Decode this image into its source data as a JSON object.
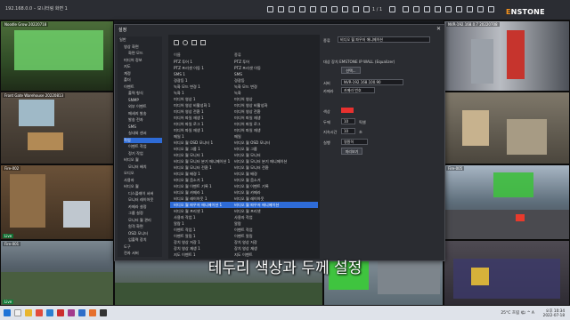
{
  "app": {
    "title": "192.168.0.0 – 모니터링 화면 1",
    "page_indicator": "1 / 1",
    "logo_prefix": "E",
    "logo_rest": "NSTONE"
  },
  "cameras": [
    {
      "label": "Noodle Grow 20220718",
      "foot": ""
    },
    {
      "label": "",
      "foot": ""
    },
    {
      "label": "",
      "foot": ""
    },
    {
      "label": "NVR-192.168.0.7 20220708",
      "foot": ""
    },
    {
      "label": "Front Gate Warehouse 20220813",
      "foot": ""
    },
    {
      "label": "",
      "foot": ""
    },
    {
      "label": "Fire-002",
      "foot": "Live"
    },
    {
      "label": "Fire-005",
      "foot": ""
    },
    {
      "label": "Fire-001",
      "foot": "Live"
    },
    {
      "label": "",
      "foot": ""
    }
  ],
  "dialog": {
    "title": "설정",
    "close": "✕",
    "tree": [
      {
        "label": "일반",
        "indent": 0
      },
      {
        "label": "영상 화면",
        "indent": 1
      },
      {
        "label": "화면 모드",
        "indent": 2
      },
      {
        "label": "미디어 정보",
        "indent": 1
      },
      {
        "label": "지도",
        "indent": 1
      },
      {
        "label": "계정",
        "indent": 1
      },
      {
        "label": "폴더",
        "indent": 1
      },
      {
        "label": "이벤트",
        "indent": 1
      },
      {
        "label": "출력 형식",
        "indent": 2
      },
      {
        "label": "SNMP",
        "indent": 2
      },
      {
        "label": "외부 이벤트",
        "indent": 2
      },
      {
        "label": "메세지 발송",
        "indent": 2
      },
      {
        "label": "발송 전자",
        "indent": 2
      },
      {
        "label": "SMS",
        "indent": 2
      },
      {
        "label": "실내외 센서",
        "indent": 2
      },
      {
        "label": "작업",
        "indent": 1,
        "selected": true
      },
      {
        "label": "이벤트 작업",
        "indent": 2
      },
      {
        "label": "정기 작업",
        "indent": 2
      },
      {
        "label": "비디오 월",
        "indent": 1
      },
      {
        "label": "모니터 배치",
        "indent": 2
      },
      {
        "label": "오디오",
        "indent": 1
      },
      {
        "label": "사용자",
        "indent": 1
      },
      {
        "label": "비디오 월",
        "indent": 1
      },
      {
        "label": "디스플레이 서버",
        "indent": 2
      },
      {
        "label": "모니터 레이아웃",
        "indent": 2
      },
      {
        "label": "카메라 설정",
        "indent": 2
      },
      {
        "label": "그룹 설정",
        "indent": 2
      },
      {
        "label": "모니터 월 관리",
        "indent": 2
      },
      {
        "label": "원격 화면",
        "indent": 2
      },
      {
        "label": "OSD 모니터",
        "indent": 2
      },
      {
        "label": "입출력 장치",
        "indent": 2
      },
      {
        "label": "도구",
        "indent": 1
      },
      {
        "label": "전자 서버",
        "indent": 1
      }
    ],
    "list_headers": {
      "name": "이름",
      "type": "종류"
    },
    "list": [
      {
        "name": "PTZ 투어 1",
        "type": "PTZ 투어"
      },
      {
        "name": "PTZ 프리셋 이동 1",
        "type": "PTZ 프리셋 이동"
      },
      {
        "name": "SMS 1",
        "type": "SMS"
      },
      {
        "name": "경광등 1",
        "type": "경광등"
      },
      {
        "name": "녹화 모드 변경 1",
        "type": "녹화 모드 변경"
      },
      {
        "name": "녹화 1",
        "type": "녹화"
      },
      {
        "name": "미디어 영상 1",
        "type": "미디어 영상"
      },
      {
        "name": "미디어 영상 비활성화 1",
        "type": "미디어 영상 비활성화"
      },
      {
        "name": "미디어 영상 전환 1",
        "type": "미디어 영상 전환"
      },
      {
        "name": "미디어 파일 재생 1",
        "type": "미디어 파일 재생"
      },
      {
        "name": "미디어 파일 로그 1",
        "type": "미디어 파일 로그"
      },
      {
        "name": "미디어 파일 재생 1",
        "type": "미디어 파일 재생"
      },
      {
        "name": "메일 1",
        "type": "메일"
      },
      {
        "name": "비디오 월 OSD 모니터 1",
        "type": "비디오 월 OSD 모니터"
      },
      {
        "name": "비디오 월 그룹 1",
        "type": "비디오 월 그룹"
      },
      {
        "name": "비디오 월 모니터 1",
        "type": "비디오 월 모니터"
      },
      {
        "name": "비디오 월 모니터 분기 애니메이션 1",
        "type": "비디오 월 모니터 분기 애니메이션"
      },
      {
        "name": "비디오 월 모니터 전환 1",
        "type": "비디오 월 모니터 전환"
      },
      {
        "name": "비디오 월 배경 1",
        "type": "비디오 월 배경"
      },
      {
        "name": "비디오 월 음소거 1",
        "type": "비디오 월 음소거"
      },
      {
        "name": "비디오 월 이벤트 기록 1",
        "type": "비디오 월 이벤트 기록"
      },
      {
        "name": "비디오 월 카메라 1",
        "type": "비디오 월 카메라"
      },
      {
        "name": "비디오 월 레이아웃 1",
        "type": "비디오 월 레이아웃"
      },
      {
        "name": "비디오 월 파우저 애니메이션 1",
        "type": "비디오 월 파우저 애니메이션",
        "selected": true
      },
      {
        "name": "비디오 월 프리셋 1",
        "type": "비디오 월 프리셋"
      },
      {
        "name": "사용자 작업 1",
        "type": "사용자 작업"
      },
      {
        "name": "알람 1",
        "type": "알람"
      },
      {
        "name": "이벤트 작업 1",
        "type": "이벤트 작업"
      },
      {
        "name": "이벤트 알림 1",
        "type": "이벤트 알림"
      },
      {
        "name": "장치 영상 저장 1",
        "type": "장치 영상 저장"
      },
      {
        "name": "장치 영상 재생 1",
        "type": "장치 영상 재생"
      },
      {
        "name": "지도 이벤트 1",
        "type": "지도 이벤트"
      }
    ],
    "props": {
      "type_label": "종류",
      "type_value": "비디오 월 파우저 애니메이션",
      "target_label": "대상 장치 EMSTONE IP WALL (Equalizer)",
      "target_button": "선택...",
      "server_label": "서버",
      "server_value": "NVR-192.168.100.90",
      "camera_label": "카메라",
      "camera_value": "카메라 번호",
      "color_label": "색상",
      "thickness_label": "두께",
      "thickness_value": "10",
      "thickness_unit": "픽셀",
      "duration_label": "지속시간",
      "duration_value": "10",
      "duration_unit": "초",
      "exec_label": "실행",
      "exec_value": "영원히",
      "exec_button": "미리보기",
      "accent": "#e8312f"
    }
  },
  "subtitle": "테두리 색상과 두께 설정",
  "taskbar": {
    "tray": "25°C 흐림 🌤  ^  A",
    "time": "오후 10:34",
    "date": "2022-07-18"
  }
}
